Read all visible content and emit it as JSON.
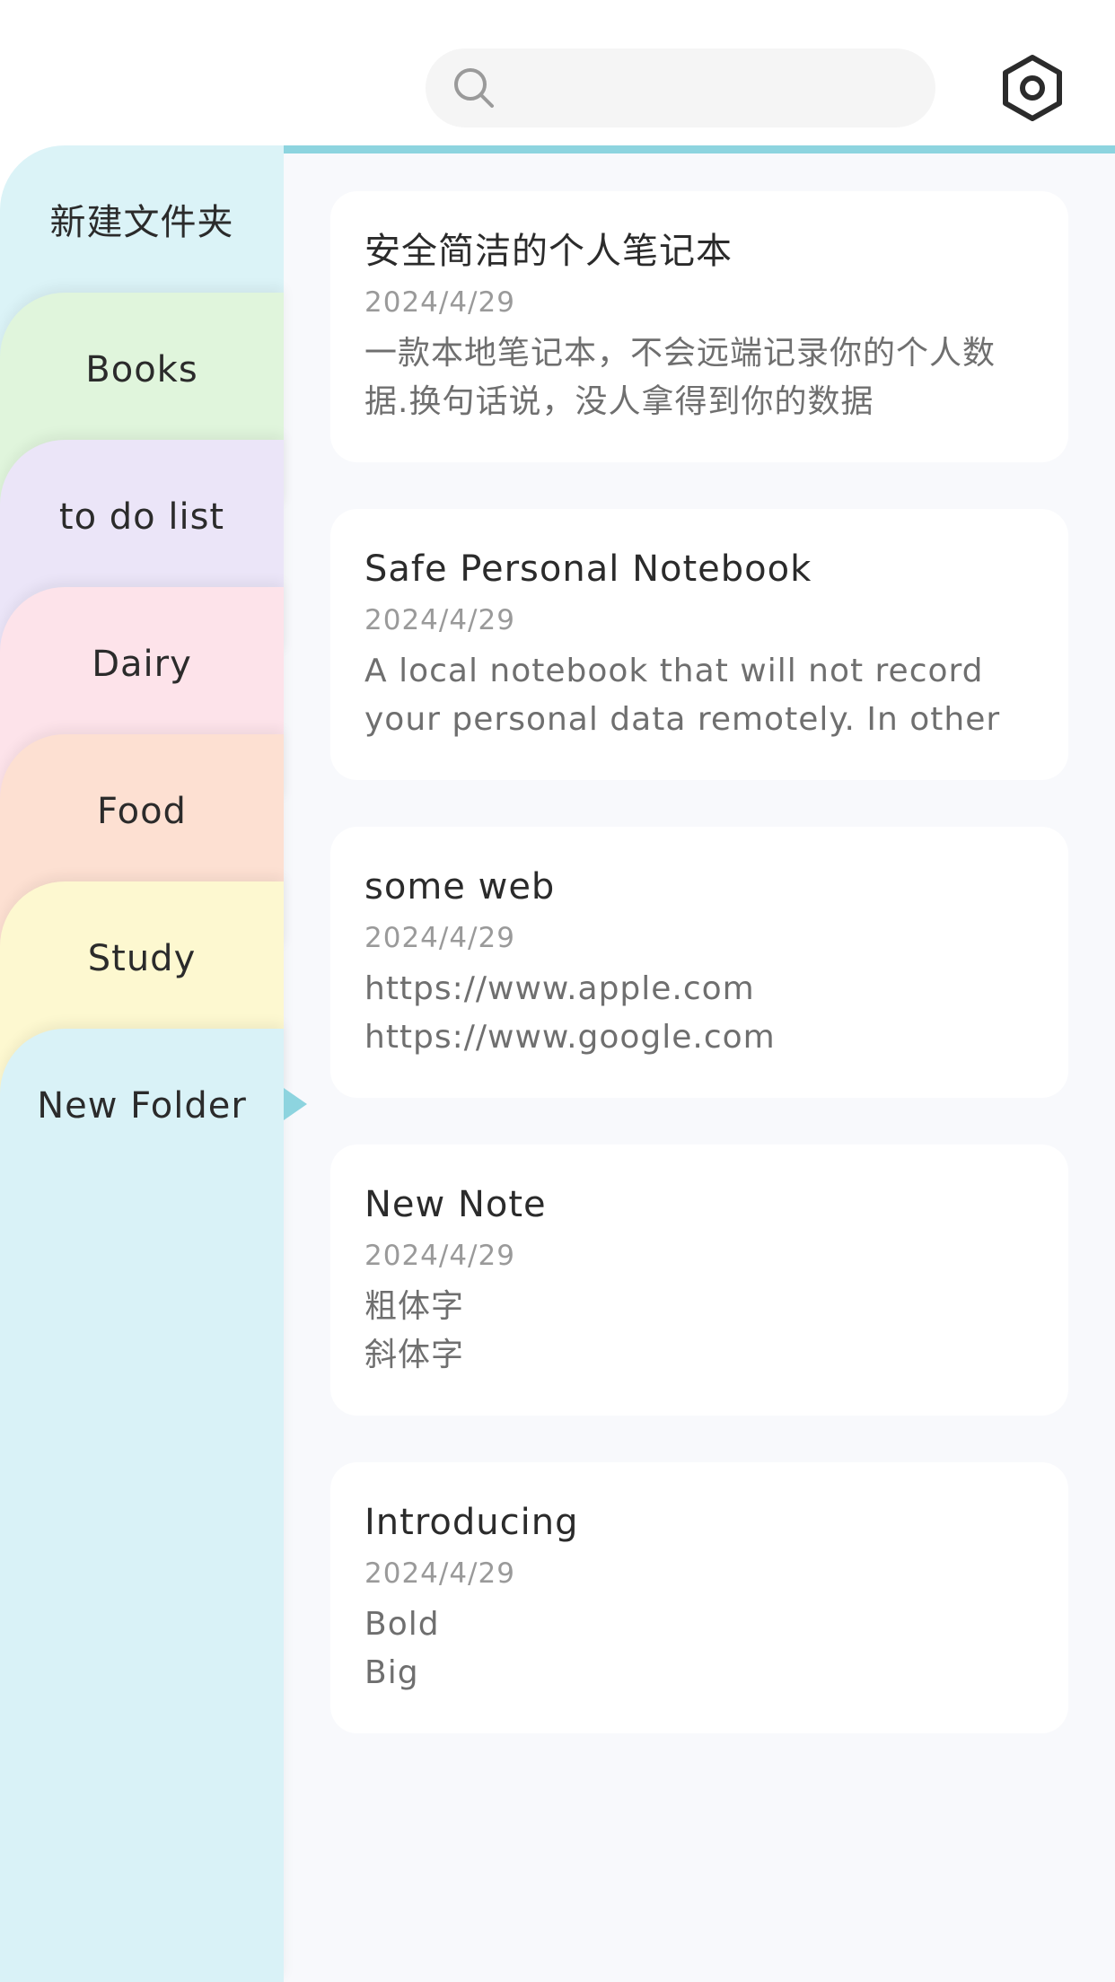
{
  "colors": {
    "accent": "#8dd4df",
    "panel_background": "#f8f9fc",
    "search_background": "#f5f5f5"
  },
  "search": {
    "icon": "search-icon",
    "value": ""
  },
  "settings": {
    "icon": "hexagon-gear-icon"
  },
  "folders": [
    {
      "label": "新建文件夹",
      "color": "#dbf3f7"
    },
    {
      "label": "Books",
      "color": "#e0f5dc"
    },
    {
      "label": "to do list",
      "color": "#ebe5f8"
    },
    {
      "label": "Dairy",
      "color": "#fde3ea"
    },
    {
      "label": "Food",
      "color": "#fde0d2"
    },
    {
      "label": "Study",
      "color": "#fdf8d0"
    },
    {
      "label": "New Folder",
      "color": "#d9f2f7",
      "selected": true
    }
  ],
  "notes": [
    {
      "title": "安全简洁的个人笔记本",
      "date": "2024/4/29",
      "preview": "一款本地笔记本，不会远端记录你的个人数\n据.换句话说，没人拿得到你的数据"
    },
    {
      "title": "Safe Personal Notebook",
      "date": "2024/4/29",
      "preview": "A local notebook that will not record\nyour personal data remotely. In other ..."
    },
    {
      "title": "some web",
      "date": "2024/4/29",
      "preview": "https://www.apple.com\nhttps://www.google.com"
    },
    {
      "title": "New Note",
      "date": "2024/4/29",
      "preview": "粗体字\n斜体字"
    },
    {
      "title": "Introducing",
      "date": "2024/4/29",
      "preview": "Bold\nBig"
    }
  ]
}
